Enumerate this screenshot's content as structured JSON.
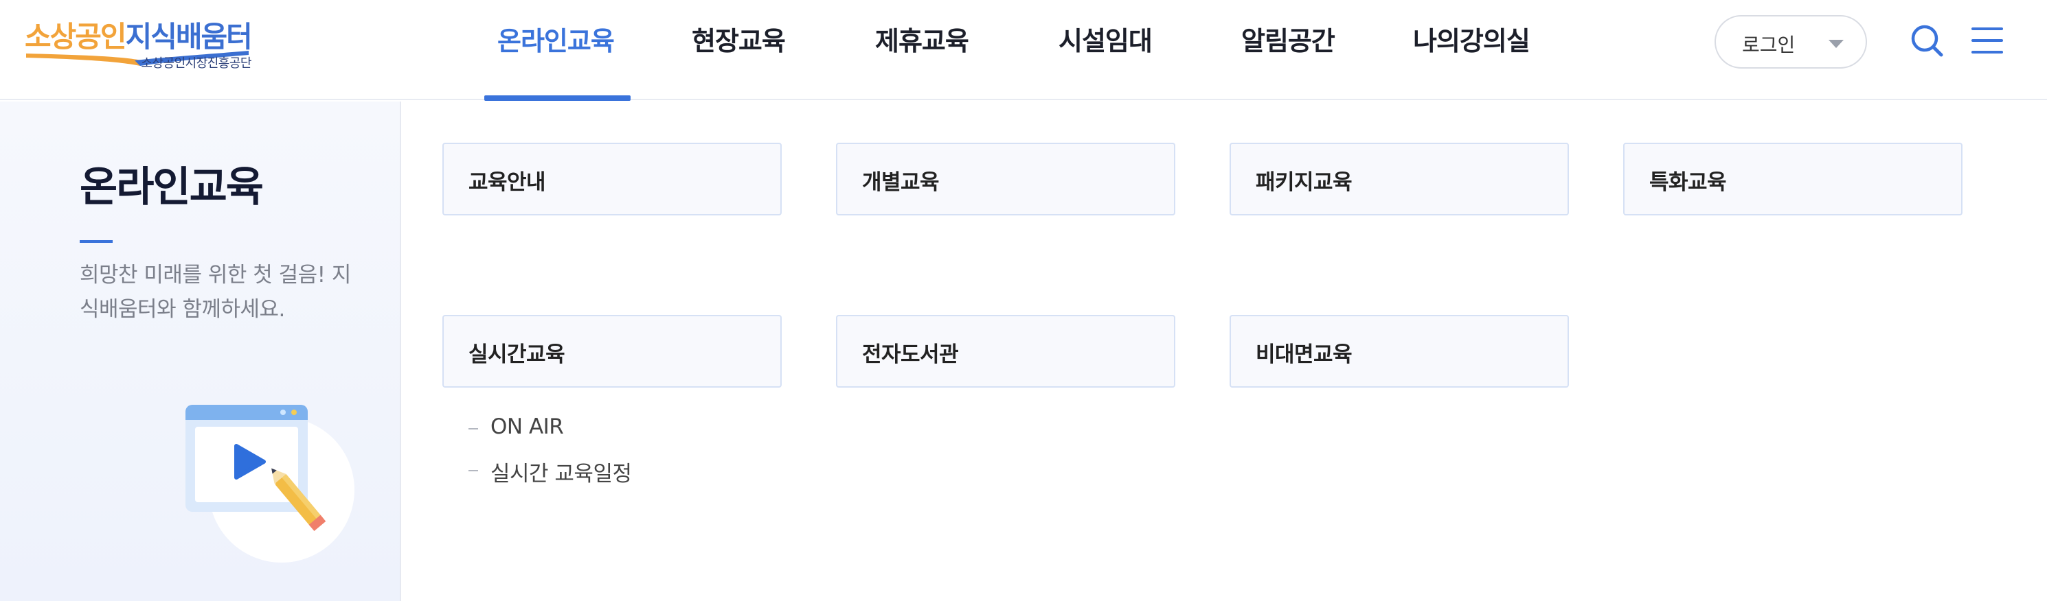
{
  "logo": {
    "main_part1": "소상공인",
    "main_part2": "지식배움터",
    "sub": "소상공인시장진흥공단"
  },
  "nav": {
    "items": [
      {
        "label": "온라인교육",
        "active": true
      },
      {
        "label": "현장교육",
        "active": false
      },
      {
        "label": "제휴교육",
        "active": false
      },
      {
        "label": "시설임대",
        "active": false
      },
      {
        "label": "알림공간",
        "active": false
      },
      {
        "label": "나의강의실",
        "active": false
      }
    ]
  },
  "header": {
    "login_label": "로그인",
    "search_icon": "search-icon",
    "menu_icon": "hamburger-menu-icon"
  },
  "side": {
    "title": "온라인교육",
    "description": "희망찬 미래를 위한 첫 걸음! 지식배움터와 함께하세요.",
    "illustration": "video-play-pencil-illustration"
  },
  "menu": {
    "cards": [
      {
        "label": "교육안내"
      },
      {
        "label": "개별교육"
      },
      {
        "label": "패키지교육"
      },
      {
        "label": "특화교육"
      },
      {
        "label": "실시간교육"
      },
      {
        "label": "전자도서관"
      },
      {
        "label": "비대면교육"
      }
    ],
    "realtime_sub": [
      {
        "label": "ON AIR"
      },
      {
        "label": "실시간 교육일정"
      }
    ]
  },
  "colors": {
    "accent": "#3a73db",
    "logo_orange": "#f2a33a",
    "text_dark": "#1c1f2a",
    "card_border": "#d6e1f5"
  }
}
